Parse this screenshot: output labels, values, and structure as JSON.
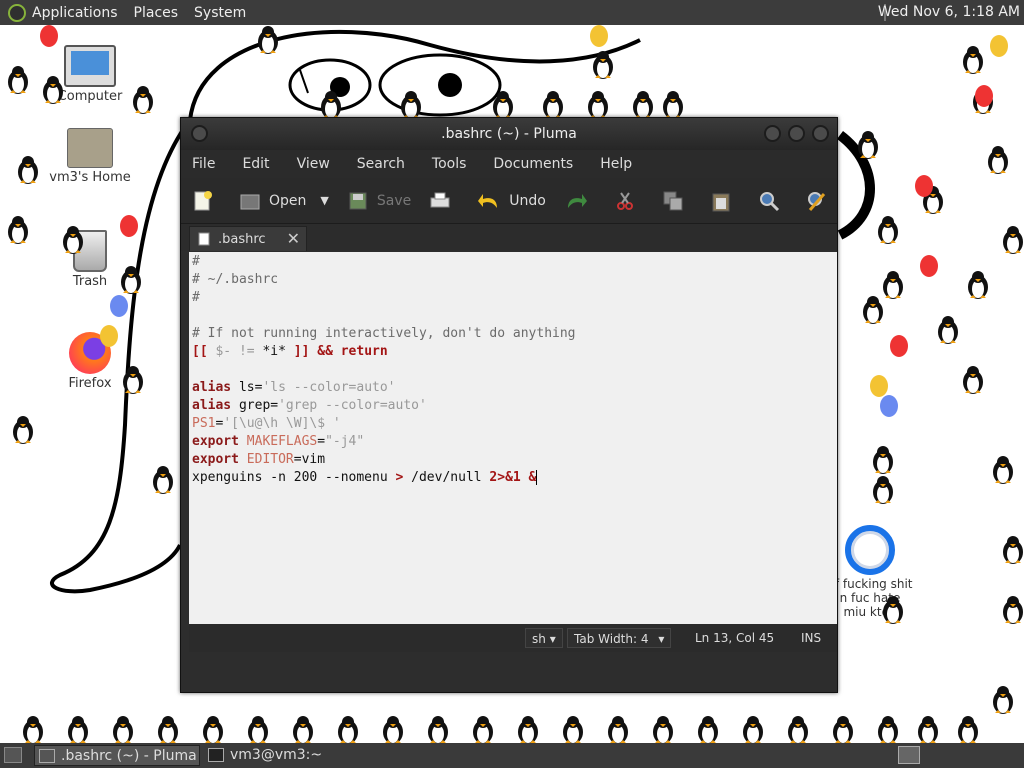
{
  "topbar": {
    "menus": [
      "Applications",
      "Places",
      "System"
    ],
    "clock": "Wed Nov 6, 1:18 AM"
  },
  "desktop": {
    "icons": [
      {
        "label": "Computer",
        "icon": "computer-icon"
      },
      {
        "label": "vm3's Home",
        "icon": "home-folder-icon"
      },
      {
        "label": "Trash",
        "icon": "trash-icon"
      },
      {
        "label": "Firefox",
        "icon": "firefox-icon"
      }
    ],
    "chrome_label_lines": [
      "of fucking shit",
      "n fuc   hate",
      "miu   ktop"
    ]
  },
  "window": {
    "title": ".bashrc (~) - Pluma",
    "menu": [
      "File",
      "Edit",
      "View",
      "Search",
      "Tools",
      "Documents",
      "Help"
    ],
    "toolbar": {
      "open": "Open",
      "save": "Save",
      "undo": "Undo"
    },
    "tab": ".bashrc",
    "lines": [
      [
        {
          "t": "#",
          "c": "cm"
        }
      ],
      [
        {
          "t": "# ~/.bashrc",
          "c": "cm"
        }
      ],
      [
        {
          "t": "#",
          "c": "cm"
        }
      ],
      [],
      [
        {
          "t": "# If not running interactively, don't do anything",
          "c": "cm"
        }
      ],
      [
        {
          "t": "[[ ",
          "c": "op"
        },
        {
          "t": "$-",
          "c": "str"
        },
        {
          "t": " != ",
          "c": "str"
        },
        {
          "t": "*i*",
          "c": ""
        },
        {
          "t": " ]] && return",
          "c": "op"
        }
      ],
      [],
      [
        {
          "t": "alias",
          "c": "kw"
        },
        {
          "t": " ls=",
          "c": ""
        },
        {
          "t": "'ls --color=auto'",
          "c": "str"
        }
      ],
      [
        {
          "t": "alias",
          "c": "kw"
        },
        {
          "t": " grep=",
          "c": ""
        },
        {
          "t": "'grep --color=auto'",
          "c": "str"
        }
      ],
      [
        {
          "t": "PS1",
          "c": "var"
        },
        {
          "t": "=",
          "c": ""
        },
        {
          "t": "'[\\u@\\h \\W]\\$ '",
          "c": "str"
        }
      ],
      [
        {
          "t": "export",
          "c": "kw"
        },
        {
          "t": " ",
          "c": ""
        },
        {
          "t": "MAKEFLAGS",
          "c": "var"
        },
        {
          "t": "=",
          "c": ""
        },
        {
          "t": "\"-j4\"",
          "c": "str"
        }
      ],
      [
        {
          "t": "export",
          "c": "kw"
        },
        {
          "t": " ",
          "c": ""
        },
        {
          "t": "EDITOR",
          "c": "var"
        },
        {
          "t": "=vim",
          "c": ""
        }
      ],
      [
        {
          "t": "xpenguins -n 200 --nomenu ",
          "c": ""
        },
        {
          "t": ">",
          "c": "op"
        },
        {
          "t": " /dev/null ",
          "c": ""
        },
        {
          "t": "2>&1 &",
          "c": "op"
        },
        {
          "t": "CARET",
          "c": "caret"
        }
      ]
    ],
    "status": {
      "language": "sh",
      "tab_width": "Tab Width:  4",
      "position": "Ln 13, Col 45",
      "mode": "INS"
    }
  },
  "taskbar": {
    "tasks": [
      ".bashrc (~) - Pluma",
      "vm3@vm3:~"
    ]
  },
  "colors": {
    "accent": "#87b33b",
    "panel": "#3c3c3c",
    "editor_bg": "#f0f0f0"
  }
}
